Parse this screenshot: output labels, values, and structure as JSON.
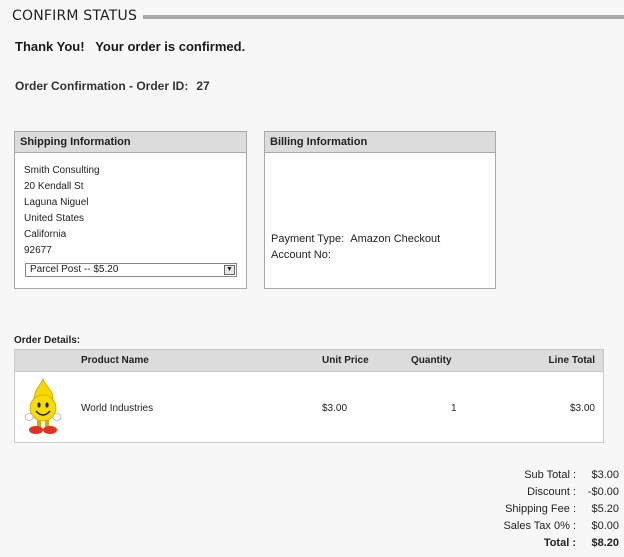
{
  "header": {
    "title": "CONFIRM STATUS"
  },
  "confirmation": {
    "thanks": "Thank You!",
    "message": "Your order is confirmed.",
    "order_label": "Order Confirmation - Order ID:",
    "order_id": "27"
  },
  "shipping": {
    "title": "Shipping Information",
    "lines": [
      "Smith Consulting",
      "20 Kendall St",
      "Laguna Niguel",
      "United States",
      "California",
      "92677"
    ],
    "method": "Parcel Post -- $5.20"
  },
  "billing": {
    "title": "Billing Information",
    "payment_type_label": "Payment Type:",
    "payment_type": "Amazon Checkout",
    "account_label": "Account No:",
    "account_no": ""
  },
  "order_details": {
    "label": "Order Details:",
    "columns": {
      "product": "Product Name",
      "unit_price": "Unit Price",
      "quantity": "Quantity",
      "line_total": "Line Total"
    },
    "rows": [
      {
        "product": "World Industries",
        "unit_price": "$3.00",
        "quantity": "1",
        "line_total": "$3.00",
        "icon": "smiley-flame-mascot-icon"
      }
    ]
  },
  "totals": {
    "sub_total_label": "Sub Total :",
    "sub_total": "$3.00",
    "discount_label": "Discount :",
    "discount": "-$0.00",
    "shipping_label": "Shipping Fee :",
    "shipping": "$5.20",
    "tax_label": "Sales Tax 0% :",
    "tax": "$0.00",
    "total_label": "Total :",
    "total": "$8.20"
  },
  "colors": {
    "header_bg": "#dcdcdc",
    "border": "#a8a8a8",
    "accent_yellow": "#f5d800",
    "mascot_red": "#e0301e"
  }
}
